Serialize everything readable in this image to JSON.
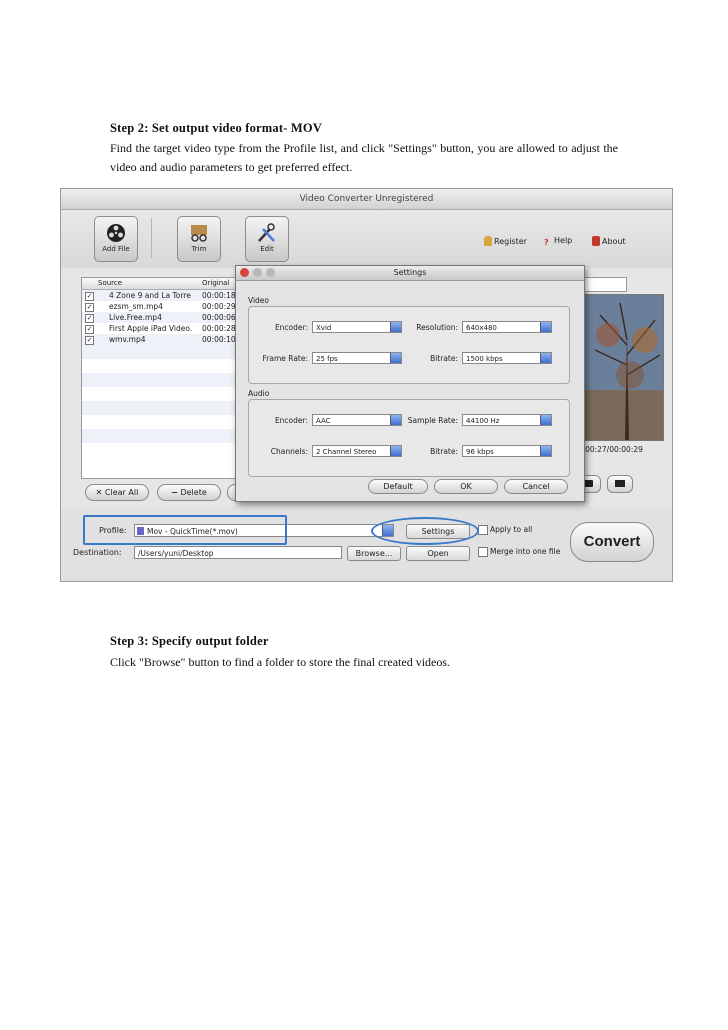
{
  "step2": {
    "heading": "Step 2: Set output video format- MOV",
    "text": "Find the target video type from the Profile list, and click \"Settings\" button, you are allowed to adjust the video and audio parameters to get preferred effect."
  },
  "step3": {
    "heading": "Step 3: Specify output folder",
    "text": "Click \"Browse\" button to find a folder to store the final created videos."
  },
  "app": {
    "window_title": "Video Converter Unregistered",
    "toolbar": {
      "add_file": "Add File",
      "trim": "Trim",
      "edit": "Edit"
    },
    "links": {
      "register": "Register",
      "help": "Help",
      "about": "About"
    },
    "file_list": {
      "col_source": "Source",
      "col_original": "Original",
      "rows": [
        {
          "name": "4 Zone 9 and La Torre",
          "time": "00:00:18"
        },
        {
          "name": "ezsm_sm.mp4",
          "time": "00:00:29"
        },
        {
          "name": "Live.Free.mp4",
          "time": "00:00:06"
        },
        {
          "name": "First Apple iPad Video.",
          "time": "00:00:28"
        },
        {
          "name": "wmv.mp4",
          "time": "00:00:10"
        }
      ]
    },
    "clear_all": "Clear All",
    "delete": "Delete",
    "preview_time": "00:00:27/00:00:29",
    "profile_label": "Profile:",
    "profile_value": "Mov - QuickTime(*.mov)",
    "settings_button": "Settings",
    "apply_to_all": "Apply to all",
    "destination_label": "Destination:",
    "destination_value": "/Users/yuni/Desktop",
    "browse": "Browse...",
    "open": "Open",
    "merge": "Merge into one file",
    "convert": "Convert"
  },
  "settings": {
    "title": "Settings",
    "video_label": "Video",
    "audio_label": "Audio",
    "video": {
      "encoder_label": "Encoder:",
      "encoder": "Xvid",
      "resolution_label": "Resolution:",
      "resolution": "640x480",
      "frame_rate_label": "Frame Rate:",
      "frame_rate": "25 fps",
      "bitrate_label": "Bitrate:",
      "bitrate": "1500 kbps"
    },
    "audio": {
      "encoder_label": "Encoder:",
      "encoder": "AAC",
      "sample_rate_label": "Sample Rate:",
      "sample_rate": "44100 Hz",
      "channels_label": "Channels:",
      "channels": "2 Channel Stereo",
      "bitrate_label": "Bitrate:",
      "bitrate": "96 kbps"
    },
    "default": "Default",
    "ok": "OK",
    "cancel": "Cancel"
  },
  "colors": {
    "highlight": "#3a78c9",
    "select_arrow": "#3f6fd0"
  }
}
